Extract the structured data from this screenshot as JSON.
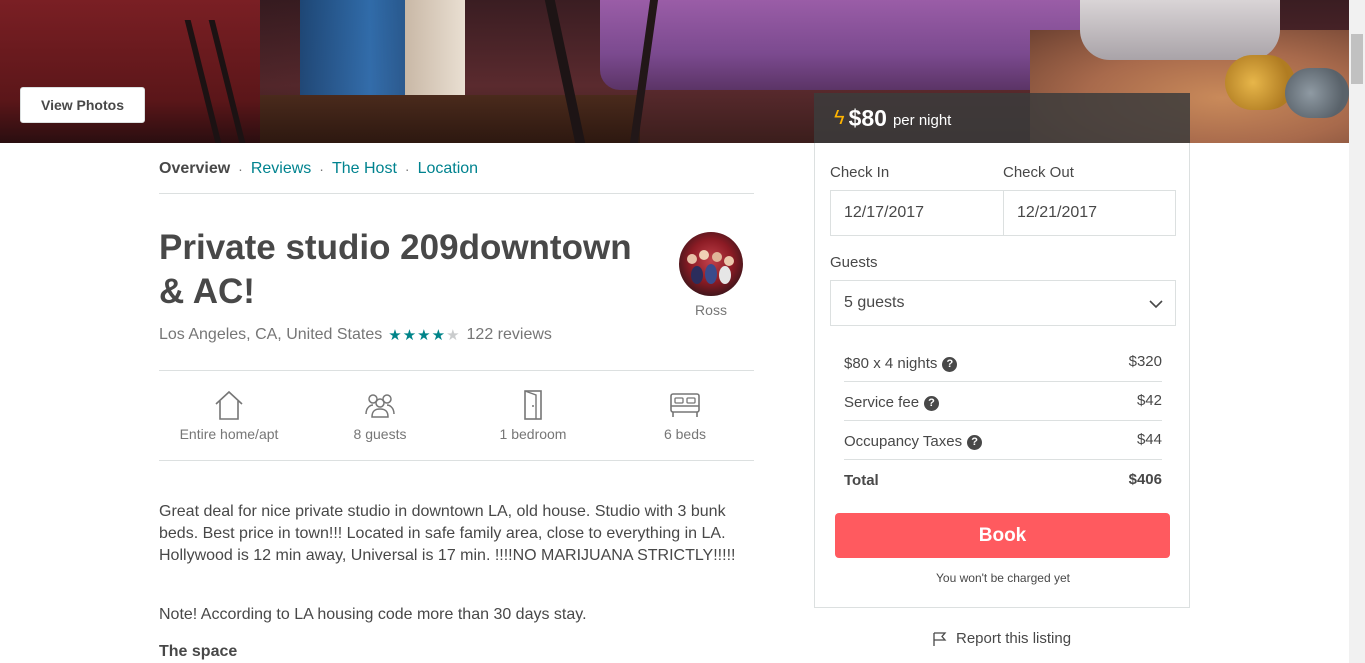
{
  "hero": {
    "view_photos_label": "View Photos"
  },
  "subnav": {
    "items": [
      "Overview",
      "Reviews",
      "The Host",
      "Location"
    ],
    "separator": "·"
  },
  "listing": {
    "title": "Private studio 209downtown & AC!",
    "location": "Los Angeles, CA, United States",
    "rating_stars": 4,
    "rating_max": 5,
    "reviews": "122 reviews",
    "host_name": "Ross",
    "amenities": [
      {
        "icon": "home-icon",
        "label": "Entire home/apt"
      },
      {
        "icon": "guests-icon",
        "label": "8 guests"
      },
      {
        "icon": "door-icon",
        "label": "1 bedroom"
      },
      {
        "icon": "bed-icon",
        "label": "6 beds"
      }
    ],
    "description": "Great deal for nice private studio in downtown LA, old house. Studio with 3 bunk beds. Best price in town!!! Located in safe family area, close to everything in LA. Hollywood is 12 min away, Universal is 17 min. !!!!NO MARIJUANA STRICTLY!!!!!",
    "note": "Note! According to LA housing code more than 30 days stay.",
    "space_heading": "The space"
  },
  "booking": {
    "price": "$80",
    "per_night": "per night",
    "check_in_label": "Check In",
    "check_out_label": "Check Out",
    "check_in_value": "12/17/2017",
    "check_out_value": "12/21/2017",
    "guests_label": "Guests",
    "guests_value": "5 guests",
    "fees": [
      {
        "name": "$80 x 4 nights",
        "value": "$320",
        "info": true
      },
      {
        "name": "Service fee",
        "value": "$42",
        "info": true
      },
      {
        "name": "Occupancy Taxes",
        "value": "$44",
        "info": true
      }
    ],
    "total_label": "Total",
    "total_value": "$406",
    "book_label": "Book",
    "charged_note": "You won't be charged yet",
    "report_label": "Report this listing"
  },
  "colors": {
    "accent_teal": "#00838f",
    "book_button": "#ff5a5f",
    "text": "#484848",
    "muted": "#767676",
    "star_on": "#008489",
    "star_off": "#cacccd"
  }
}
